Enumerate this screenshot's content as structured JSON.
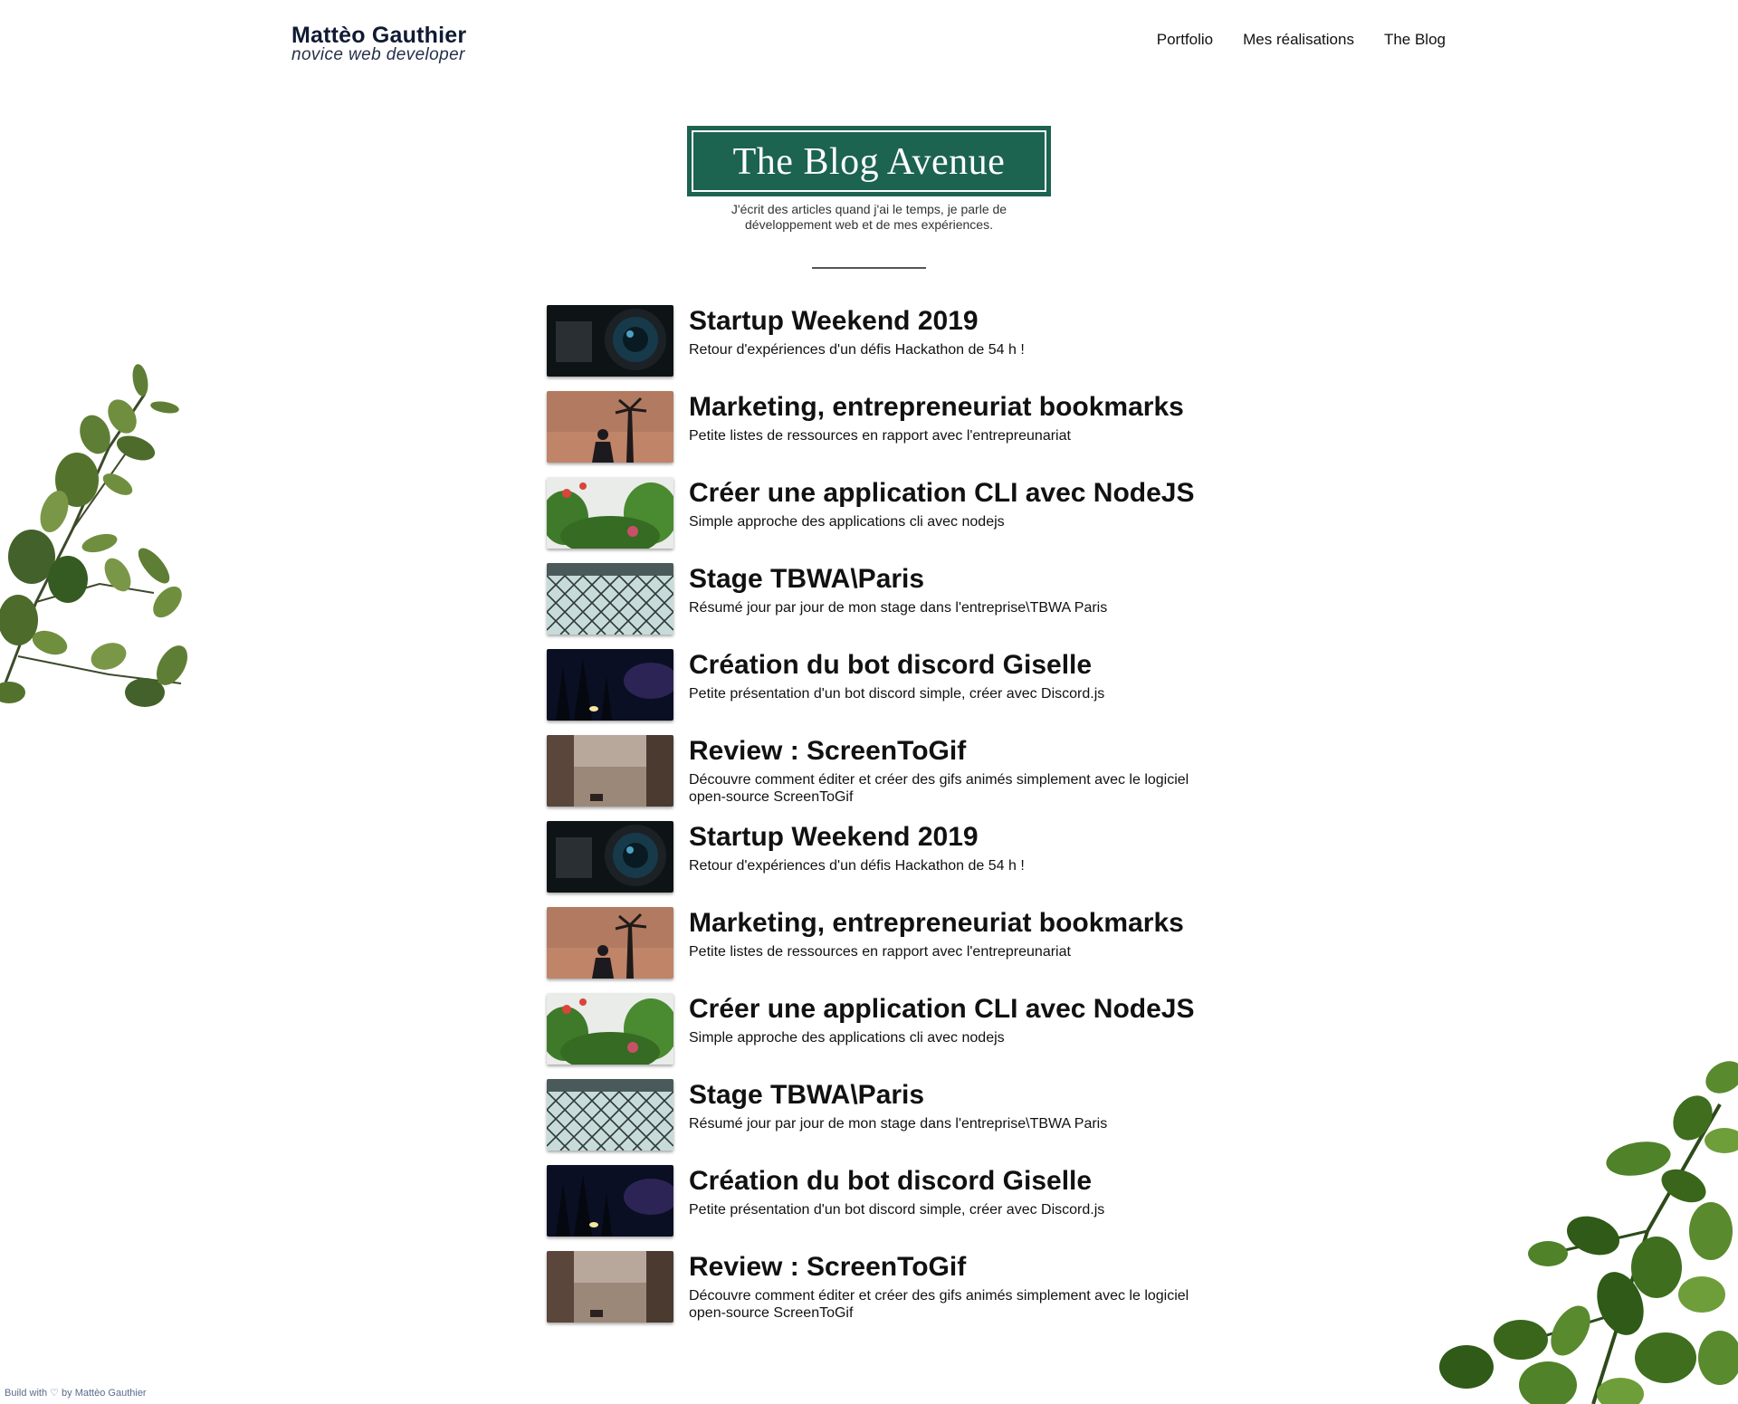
{
  "header": {
    "brand_name": "Mattèo Gauthier",
    "brand_tagline": "novice web developer",
    "nav": [
      "Portfolio",
      "Mes réalisations",
      "The Blog"
    ]
  },
  "hero": {
    "title": "The Blog Avenue",
    "description": "J'écrit des articles quand j'ai le temps, je parle de développement web et de mes expériences.",
    "accent_color": "#1c6350"
  },
  "posts": [
    {
      "title": "Startup Weekend 2019",
      "description": "Retour d'expériences d'un défis Hackathon de 54 h !",
      "thumb_icon": "camera-lens-photo"
    },
    {
      "title": "Marketing, entrepreneuriat bookmarks",
      "description": "Petite listes de ressources en rapport avec l'entrepreunariat",
      "thumb_icon": "sunset-silhouette-photo"
    },
    {
      "title": "Créer une application CLI avec NodeJS",
      "description": "Simple approche des applications cli avec nodejs",
      "thumb_icon": "plants-photo"
    },
    {
      "title": "Stage TBWA\\Paris",
      "description": "Résumé jour par jour de mon stage dans l'entreprise\\TBWA Paris",
      "thumb_icon": "chain-fence-photo"
    },
    {
      "title": "Création du bot discord Giselle",
      "description": "Petite présentation d'un bot discord simple, créer avec Discord.js",
      "thumb_icon": "night-forest-photo"
    },
    {
      "title": "Review : ScreenToGif",
      "description": "Découvre comment éditer et créer des gifs animés simplement avec le logiciel open-source ScreenToGif",
      "thumb_icon": "beach-window-photo"
    },
    {
      "title": "Startup Weekend 2019",
      "description": "Retour d'expériences d'un défis Hackathon de 54 h !",
      "thumb_icon": "camera-lens-photo"
    },
    {
      "title": "Marketing, entrepreneuriat bookmarks",
      "description": "Petite listes de ressources en rapport avec l'entrepreunariat",
      "thumb_icon": "sunset-silhouette-photo"
    },
    {
      "title": "Créer une application CLI avec NodeJS",
      "description": "Simple approche des applications cli avec nodejs",
      "thumb_icon": "plants-photo"
    },
    {
      "title": "Stage TBWA\\Paris",
      "description": "Résumé jour par jour de mon stage dans l'entreprise\\TBWA Paris",
      "thumb_icon": "chain-fence-photo"
    },
    {
      "title": "Création du bot discord Giselle",
      "description": "Petite présentation d'un bot discord simple, créer avec Discord.js",
      "thumb_icon": "night-forest-photo"
    },
    {
      "title": "Review : ScreenToGif",
      "description": "Découvre comment éditer et créer des gifs animés simplement avec le logiciel open-source ScreenToGif",
      "thumb_icon": "beach-window-photo"
    }
  ],
  "footer": {
    "note": "Build with ♡ by Mattèo Gauthier"
  }
}
